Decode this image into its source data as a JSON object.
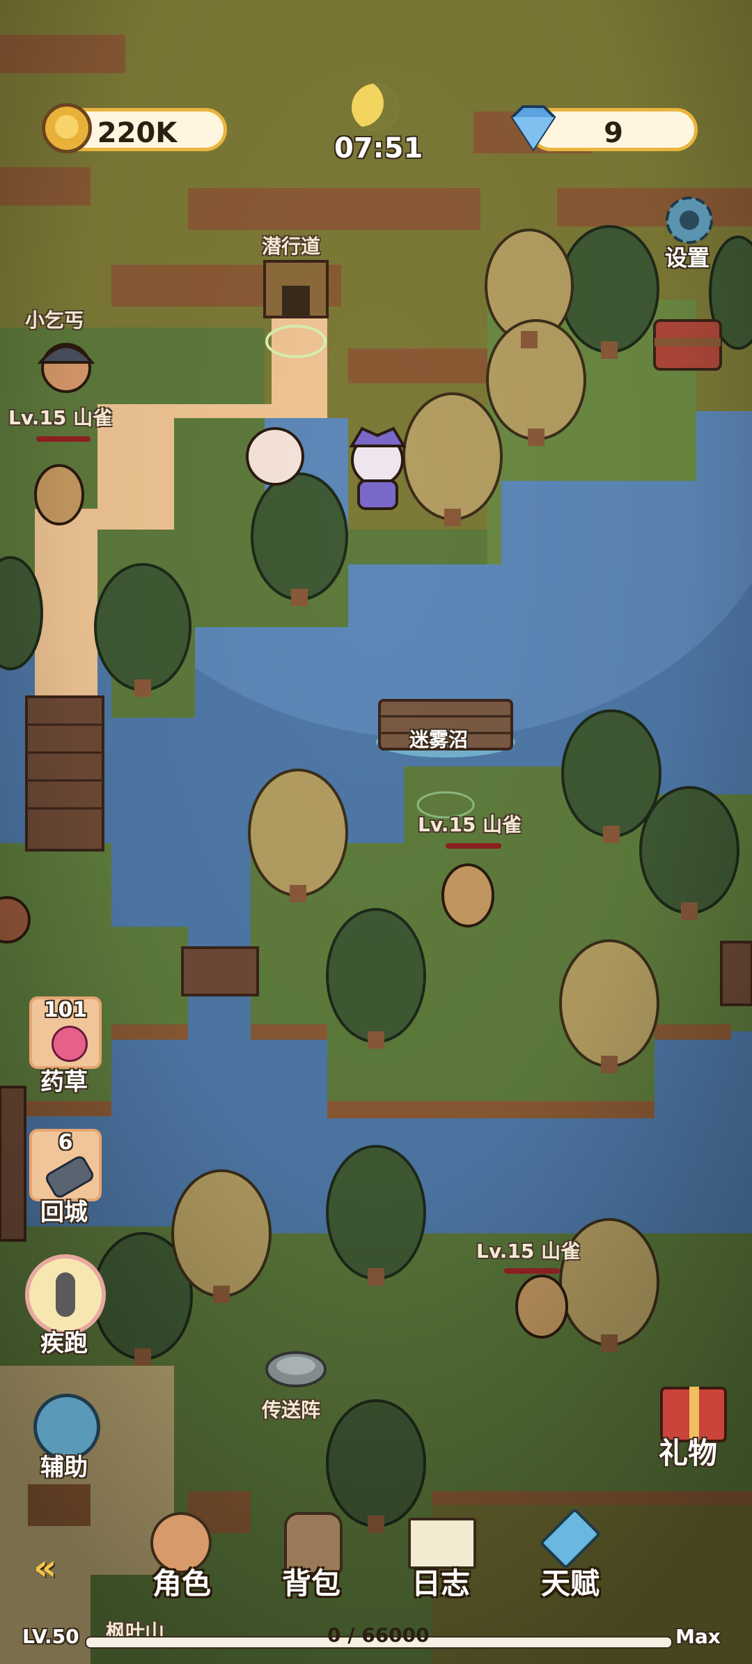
{
  "hud": {
    "gold": "220K",
    "gems": "9",
    "time": "07:51",
    "settings_label": "设置"
  },
  "map_labels": {
    "sneak_path": "潜行道",
    "beggar": "小乞丐",
    "mist_swamp": "迷雾沼",
    "teleport": "传送阵",
    "maple_mountain": "枫叶山"
  },
  "enemies": [
    {
      "label": "Lv.15 山雀"
    },
    {
      "label": "Lv.15 山雀"
    },
    {
      "label": "Lv.15 山雀"
    }
  ],
  "side_buttons": {
    "herb": {
      "count": "101",
      "label": "药草"
    },
    "return_city": {
      "count": "6",
      "label": "回城"
    },
    "sprint": {
      "label": "疾跑"
    },
    "assist": {
      "label": "辅助"
    },
    "gift": {
      "label": "礼物"
    }
  },
  "bottom_nav": {
    "character": "角色",
    "backpack": "背包",
    "journal": "日志",
    "talent": "天赋"
  },
  "xp": {
    "level": "LV.50",
    "progress_text": "0 / 66000",
    "max_label": "Max",
    "fill_fraction": 0
  }
}
